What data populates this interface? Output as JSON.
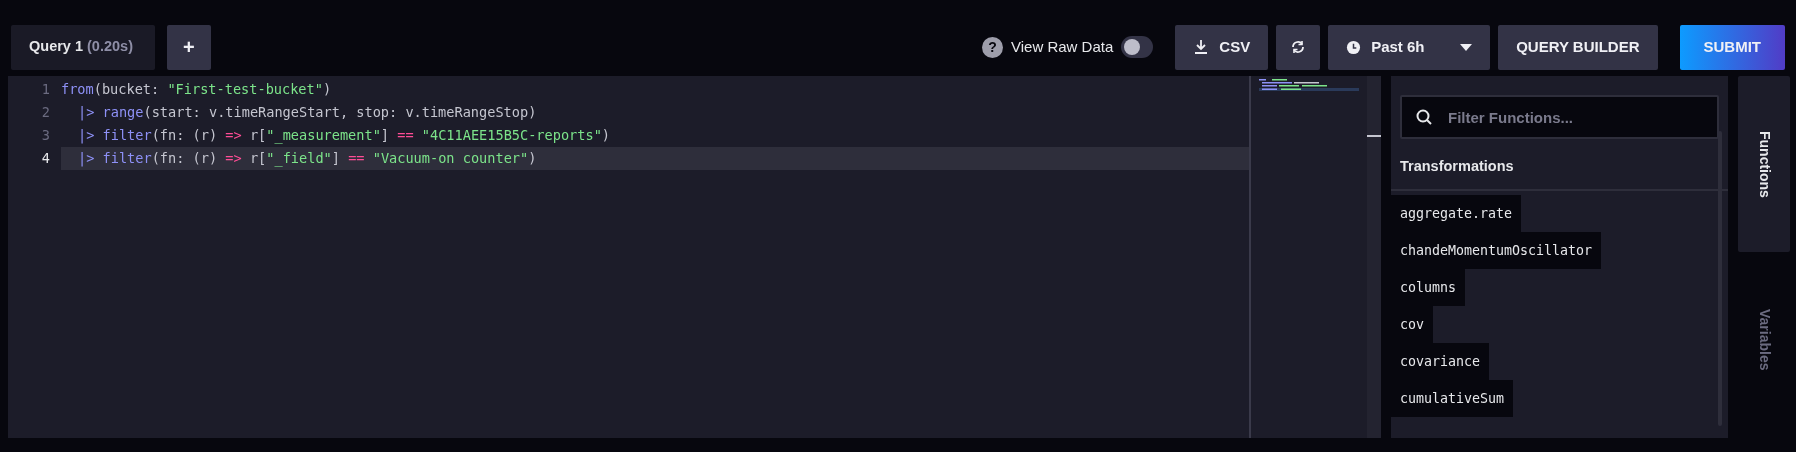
{
  "query_tab": {
    "label": "Query 1",
    "timing": "(0.20s)",
    "selected": true
  },
  "add_query_button": {
    "label": "+"
  },
  "view_raw_data": {
    "label": "View Raw Data",
    "help": "?",
    "on": false
  },
  "csv_button": {
    "label": "CSV"
  },
  "time_range": {
    "label": "Past 6h"
  },
  "query_builder_button": {
    "label": "QUERY BUILDER"
  },
  "submit_button": {
    "label": "SUBMIT"
  },
  "editor": {
    "lines": [
      {
        "number": "1",
        "selected": false,
        "tokens": [
          {
            "kind": "func",
            "text": "from"
          },
          {
            "kind": "plain",
            "text": "(bucket: "
          },
          {
            "kind": "string",
            "text": "\"First-test-bucket\""
          },
          {
            "kind": "plain",
            "text": ")"
          }
        ]
      },
      {
        "number": "2",
        "selected": false,
        "indented": true,
        "tokens": [
          {
            "kind": "pipe",
            "text": "|> "
          },
          {
            "kind": "func",
            "text": "range"
          },
          {
            "kind": "plain",
            "text": "(start: v.timeRangeStart, stop: v.timeRangeStop)"
          }
        ]
      },
      {
        "number": "3",
        "selected": false,
        "indented": true,
        "tokens": [
          {
            "kind": "pipe",
            "text": "|> "
          },
          {
            "kind": "func",
            "text": "filter"
          },
          {
            "kind": "plain",
            "text": "(fn: (r) "
          },
          {
            "kind": "operator",
            "text": "=>"
          },
          {
            "kind": "plain",
            "text": " r["
          },
          {
            "kind": "string",
            "text": "\"_measurement\""
          },
          {
            "kind": "plain",
            "text": "] "
          },
          {
            "kind": "operator",
            "text": "=="
          },
          {
            "kind": "string",
            "text": " \"4C11AEE15B5C-reports\""
          },
          {
            "kind": "plain",
            "text": ")"
          }
        ]
      },
      {
        "number": "4",
        "selected": true,
        "indented": true,
        "tokens": [
          {
            "kind": "pipe",
            "text": "|> "
          },
          {
            "kind": "func",
            "text": "filter"
          },
          {
            "kind": "plain",
            "text": "(fn: (r) "
          },
          {
            "kind": "operator",
            "text": "=>"
          },
          {
            "kind": "plain",
            "text": " r["
          },
          {
            "kind": "string",
            "text": "\"_field\""
          },
          {
            "kind": "plain",
            "text": "] "
          },
          {
            "kind": "operator",
            "text": "=="
          },
          {
            "kind": "string",
            "text": " \"Vacuum-on counter\""
          },
          {
            "kind": "plain",
            "text": ")"
          }
        ]
      }
    ]
  },
  "functions_panel": {
    "search": {
      "placeholder": "Filter Functions..."
    },
    "section": "Transformations",
    "items": [
      {
        "label": "aggregate.rate"
      },
      {
        "label": "chandeMomentumOscillator"
      },
      {
        "label": "columns"
      },
      {
        "label": "cov"
      },
      {
        "label": "covariance"
      },
      {
        "label": "cumulativeSum"
      }
    ]
  },
  "side_tabs": [
    {
      "label": "Functions",
      "selected": true
    },
    {
      "label": "Variables",
      "selected": false
    }
  ]
}
